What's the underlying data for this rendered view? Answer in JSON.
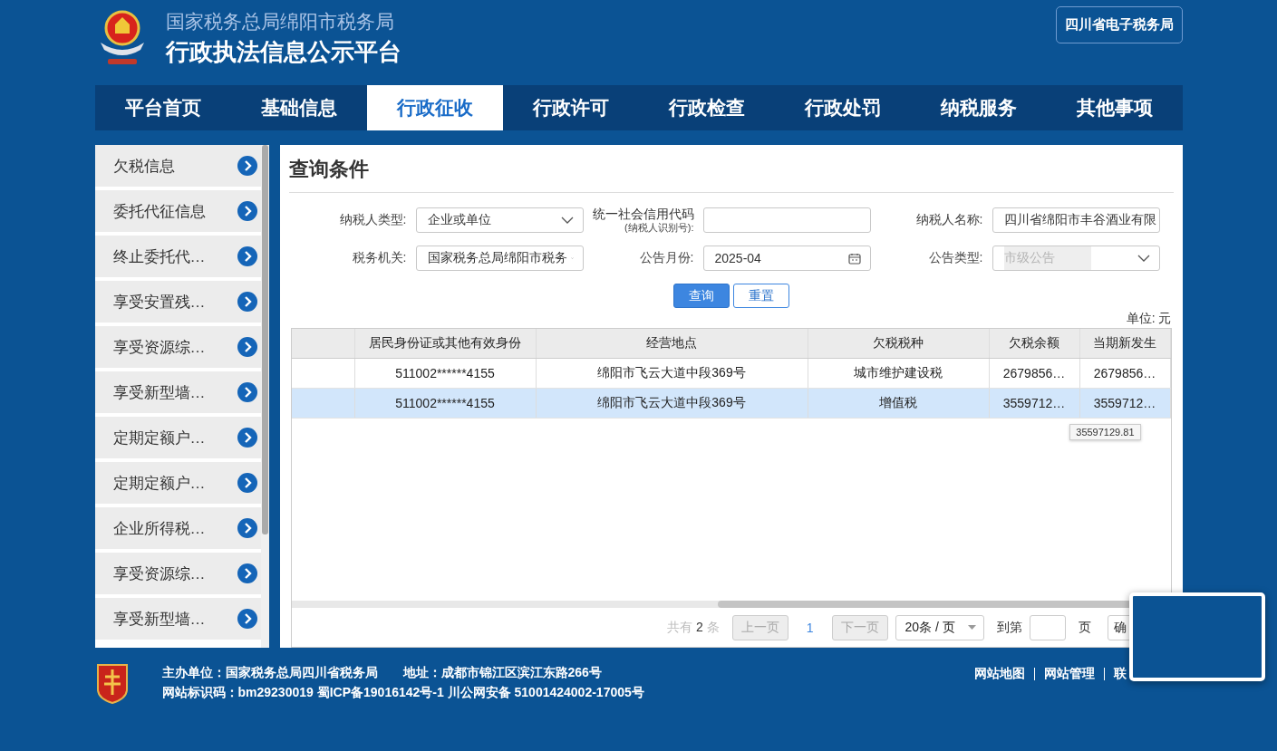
{
  "header": {
    "subtitle": "国家税务总局绵阳市税务局",
    "title": "行政执法信息公示平台",
    "link_button": "四川省电子税务局"
  },
  "nav": [
    {
      "label": "平台首页",
      "selected": false
    },
    {
      "label": "基础信息",
      "selected": false
    },
    {
      "label": "行政征收",
      "selected": true
    },
    {
      "label": "行政许可",
      "selected": false
    },
    {
      "label": "行政检查",
      "selected": false
    },
    {
      "label": "行政处罚",
      "selected": false
    },
    {
      "label": "纳税服务",
      "selected": false
    },
    {
      "label": "其他事项",
      "selected": false
    }
  ],
  "sidebar": {
    "items": [
      {
        "label": "欠税信息"
      },
      {
        "label": "委托代征信息"
      },
      {
        "label": "终止委托代…"
      },
      {
        "label": "享受安置残…"
      },
      {
        "label": "享受资源综…"
      },
      {
        "label": "享受新型墙…"
      },
      {
        "label": "定期定额户…"
      },
      {
        "label": "定期定额户…"
      },
      {
        "label": "企业所得税…"
      },
      {
        "label": "享受资源综…"
      },
      {
        "label": "享受新型墙…"
      }
    ]
  },
  "query": {
    "title": "查询条件",
    "fields": [
      {
        "label": "纳税人类型:",
        "kind": "select",
        "value": "企业或单位",
        "disabled": false
      },
      {
        "label": "统一社会信用代码",
        "sublabel": "(纳税人识别号):",
        "kind": "input",
        "disabled": false
      },
      {
        "label": "纳税人名称:",
        "kind": "input",
        "value": "四川省绵阳市丰谷酒业有限",
        "disabled": false
      },
      {
        "label": "税务机关:",
        "kind": "select",
        "value": "国家税务总局绵阳市税务",
        "disabled": false
      },
      {
        "label": "公告月份:",
        "kind": "date",
        "value": "2025-04",
        "disabled": false
      },
      {
        "label": "公告类型:",
        "kind": "select",
        "placeholder": "市级公告",
        "disabled": true
      }
    ],
    "buttons": [
      {
        "label": "查询",
        "kind": "primary"
      },
      {
        "label": "重置",
        "kind": "plain"
      }
    ],
    "unit": "单位: 元"
  },
  "table": {
    "columns": [
      "",
      "居民身份证或其他有效身份",
      "经营地点",
      "欠税税种",
      "欠税余额",
      "当期新发生"
    ],
    "rows": [
      {
        "cells": [
          "",
          "511002******4155",
          "绵阳市飞云大道中段369号",
          "城市维护建设税",
          "2679856…",
          "2679856…"
        ],
        "selected": false
      },
      {
        "cells": [
          "",
          "511002******4155",
          "绵阳市飞云大道中段369号",
          "增值税",
          "3559712…",
          "3559712…"
        ],
        "selected": true
      }
    ],
    "tooltip": "35597129.81"
  },
  "pagination": {
    "total_prefix": "共有",
    "total": "2",
    "total_suffix": "条",
    "prev": "上一页",
    "page": "1",
    "next": "下一页",
    "page_size": "20条 / 页",
    "goto_label": "到第",
    "goto_suffix": "页",
    "confirm": "确"
  },
  "footer": {
    "line1": "主办单位：国家税务总局四川省税务局　　地址：成都市锦江区滨江东路266号",
    "line2": "网站标识码：bm29230019 蜀ICP备19016142号-1 川公网安备 51001424002-17005号",
    "links": [
      "网站地图",
      "网站管理",
      "联"
    ]
  }
}
